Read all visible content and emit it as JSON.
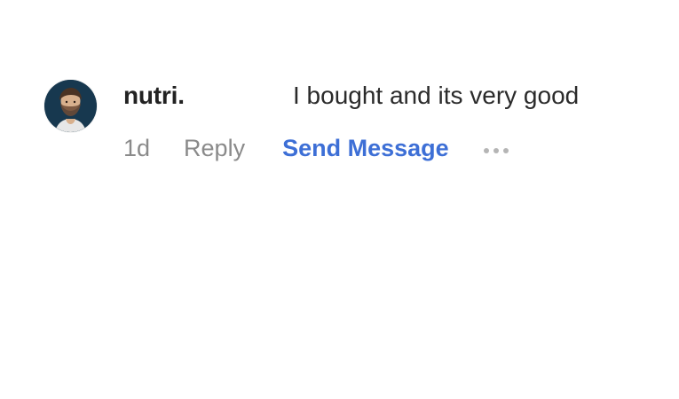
{
  "comment": {
    "author": "nutri.",
    "text": "I bought and its very good",
    "time": "1d",
    "reply_label": "Reply",
    "send_message_label": "Send Message",
    "more_icon": "more-dots-icon",
    "avatar_icon": "avatar-icon"
  },
  "colors": {
    "author": "#222222",
    "text": "#2b2b2b",
    "meta": "#8a8a8a",
    "link": "#3d6fd6",
    "avatar_bg": "#17384f",
    "more_dots": "#b5b5b5"
  }
}
